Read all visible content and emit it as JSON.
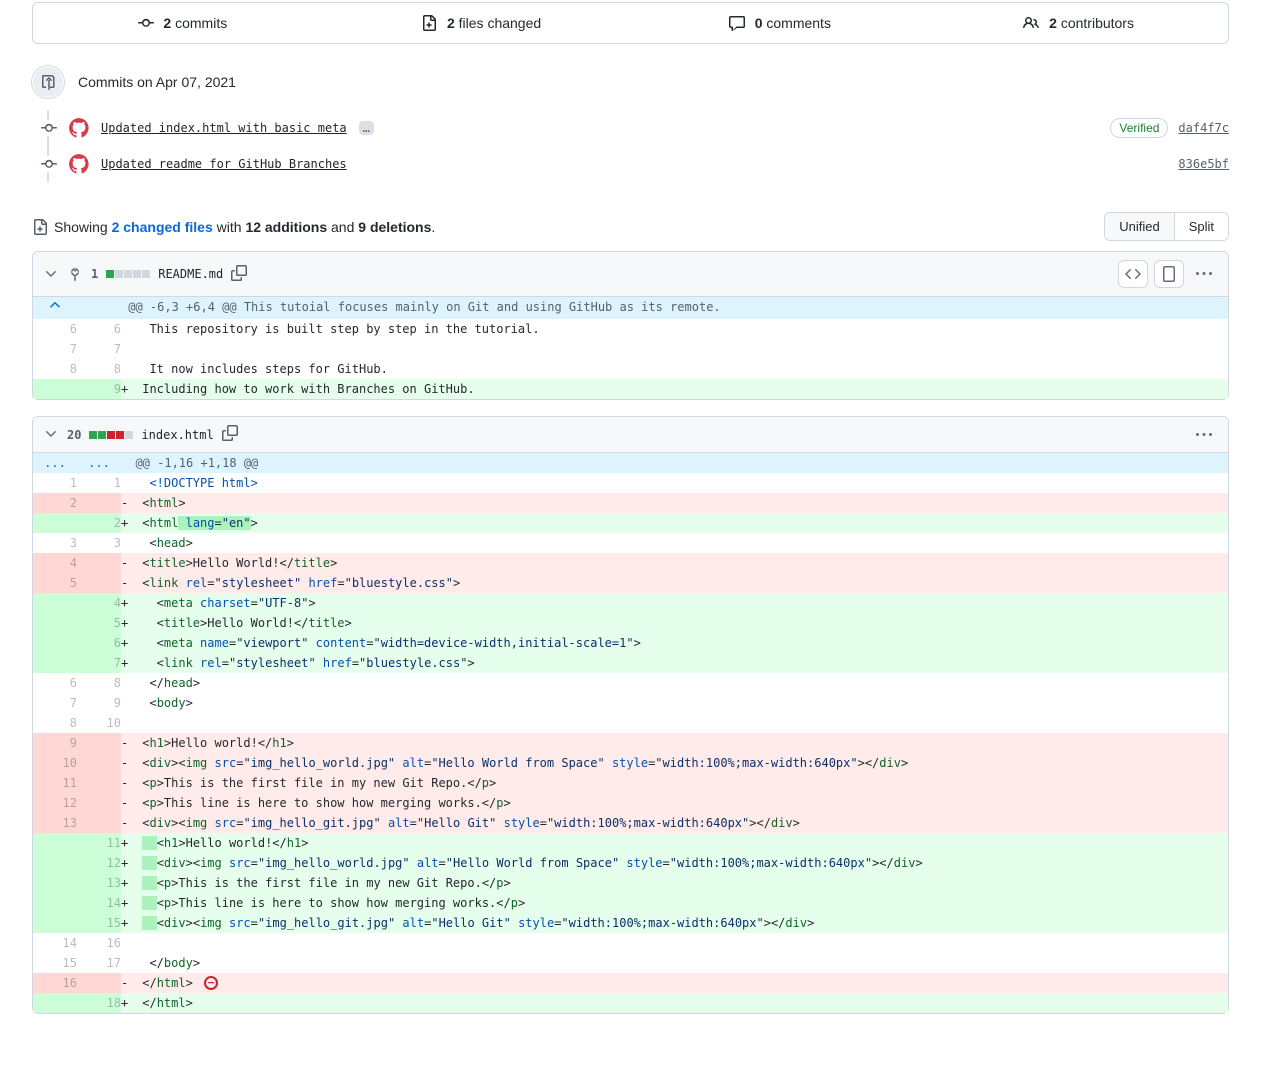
{
  "tabs": {
    "commits": {
      "icon": "git-commit",
      "count": "2",
      "label": "commits"
    },
    "files": {
      "icon": "file-diff",
      "count": "2",
      "label": "files changed"
    },
    "comments": {
      "icon": "comment",
      "count": "0",
      "label": "comments"
    },
    "contributors": {
      "icon": "people",
      "count": "2",
      "label": "contributors"
    }
  },
  "timeline": {
    "heading": "Commits on Apr 07, 2021",
    "items": [
      {
        "msg": "Updated index.html with basic meta",
        "more": "…",
        "verified": "Verified",
        "sha": "daf4f7c"
      },
      {
        "msg": "Updated readme for GitHub Branches",
        "sha": "836e5bf"
      }
    ]
  },
  "summary": {
    "showing": "Showing ",
    "files_link": "2 changed files",
    "with": " with ",
    "additions": "12 additions",
    "and": " and ",
    "deletions": "9 deletions",
    "unified": "Unified",
    "split": "Split"
  },
  "files": [
    {
      "name": "README.md",
      "count": "1",
      "blocks": {
        "a": 1,
        "d": 0,
        "n": 4
      },
      "hasViewTools": true,
      "hunks": [
        {
          "type": "hunk",
          "expand": "up",
          "text": " @@ -6,3 +6,4 @@ This tutoial focuses mainly on Git and using GitHub as its remote."
        },
        {
          "type": "ctx",
          "o": "6",
          "n": "6",
          "plain": "  This repository is built step by step in the tutorial."
        },
        {
          "type": "ctx",
          "o": "7",
          "n": "7",
          "plain": "  "
        },
        {
          "type": "ctx",
          "o": "8",
          "n": "8",
          "plain": "  It now includes steps for GitHub."
        },
        {
          "type": "add",
          "n": "9",
          "sign": "+",
          "plain": " Including how to work with Branches on GitHub."
        }
      ]
    },
    {
      "name": "index.html",
      "count": "20",
      "blocks": {
        "a": 2,
        "d": 2,
        "n": 1
      },
      "hasViewTools": false,
      "hunks": [
        {
          "type": "hunk",
          "expand": "dots",
          "text": "  @@ -1,16 +1,18 @@"
        },
        {
          "type": "ctx",
          "o": "1",
          "n": "1",
          "html": "  <span class='s-doc'>&lt;!DOCTYPE html&gt;</span>"
        },
        {
          "type": "del",
          "o": "2",
          "sign": "-",
          "html": " &lt;<span class='s-tag'>html</span>&gt;"
        },
        {
          "type": "add",
          "n": "2",
          "sign": "+",
          "html": " &lt;<span class='s-tag'>html</span><span class='ws-add'> <span class='s-attr'>lang</span>=<span class='s-str'>\"en\"</span></span>&gt;"
        },
        {
          "type": "ctx",
          "o": "3",
          "n": "3",
          "html": "  &lt;<span class='s-tag'>head</span>&gt;"
        },
        {
          "type": "del",
          "o": "4",
          "sign": "-",
          "html": " &lt;<span class='s-tag'>title</span>&gt;Hello World!&lt;/<span class='s-tag'>title</span>&gt;"
        },
        {
          "type": "del",
          "o": "5",
          "sign": "-",
          "html": " &lt;<span class='s-tag'>link</span> <span class='s-attr'>rel</span>=<span class='s-str'>\"stylesheet\"</span> <span class='s-attr'>href</span>=<span class='s-str'>\"bluestyle.css\"</span>&gt;"
        },
        {
          "type": "add",
          "n": "4",
          "sign": "+",
          "html": "   &lt;<span class='s-tag'>meta</span> <span class='s-attr'>charset</span>=<span class='s-str'>\"UTF-8\"</span>&gt;"
        },
        {
          "type": "add",
          "n": "5",
          "sign": "+",
          "html": "   &lt;<span class='s-tag'>title</span>&gt;Hello World!&lt;/<span class='s-tag'>title</span>&gt;"
        },
        {
          "type": "add",
          "n": "6",
          "sign": "+",
          "html": "   &lt;<span class='s-tag'>meta</span> <span class='s-attr'>name</span>=<span class='s-str'>\"viewport\"</span> <span class='s-attr'>content</span>=<span class='s-str'>\"width=device-width,initial-scale=1\"</span>&gt;"
        },
        {
          "type": "add",
          "n": "7",
          "sign": "+",
          "html": "   &lt;<span class='s-tag'>link</span> <span class='s-attr'>rel</span>=<span class='s-str'>\"stylesheet\"</span> <span class='s-attr'>href</span>=<span class='s-str'>\"bluestyle.css\"</span>&gt;"
        },
        {
          "type": "ctx",
          "o": "6",
          "n": "8",
          "html": "  &lt;/<span class='s-tag'>head</span>&gt;"
        },
        {
          "type": "ctx",
          "o": "7",
          "n": "9",
          "html": "  &lt;<span class='s-tag'>body</span>&gt;"
        },
        {
          "type": "ctx",
          "o": "8",
          "n": "10",
          "html": "  "
        },
        {
          "type": "del",
          "o": "9",
          "sign": "-",
          "html": " &lt;<span class='s-tag'>h1</span>&gt;Hello world!&lt;/<span class='s-tag'>h1</span>&gt;"
        },
        {
          "type": "del",
          "o": "10",
          "sign": "-",
          "html": " &lt;<span class='s-tag'>div</span>&gt;&lt;<span class='s-tag'>img</span> <span class='s-attr'>src</span>=<span class='s-str'>\"img_hello_world.jpg\"</span> <span class='s-attr'>alt</span>=<span class='s-str'>\"Hello World from Space\"</span> <span class='s-attr'>style</span>=<span class='s-str'>\"width:100%;max-width:640px\"</span>&gt;&lt;/<span class='s-tag'>div</span>&gt;"
        },
        {
          "type": "del",
          "o": "11",
          "sign": "-",
          "html": " &lt;<span class='s-tag'>p</span>&gt;This is the first file in my new Git Repo.&lt;/<span class='s-tag'>p</span>&gt;"
        },
        {
          "type": "del",
          "o": "12",
          "sign": "-",
          "html": " &lt;<span class='s-tag'>p</span>&gt;This line is here to show how merging works.&lt;/<span class='s-tag'>p</span>&gt;"
        },
        {
          "type": "del",
          "o": "13",
          "sign": "-",
          "html": " &lt;<span class='s-tag'>div</span>&gt;&lt;<span class='s-tag'>img</span> <span class='s-attr'>src</span>=<span class='s-str'>\"img_hello_git.jpg\"</span> <span class='s-attr'>alt</span>=<span class='s-str'>\"Hello Git\"</span> <span class='s-attr'>style</span>=<span class='s-str'>\"width:100%;max-width:640px\"</span>&gt;&lt;/<span class='s-tag'>div</span>&gt;"
        },
        {
          "type": "add",
          "n": "11",
          "sign": "+",
          "html": " <span class='ws-add'>  </span>&lt;<span class='s-tag'>h1</span>&gt;Hello world!&lt;/<span class='s-tag'>h1</span>&gt;"
        },
        {
          "type": "add",
          "n": "12",
          "sign": "+",
          "html": " <span class='ws-add'>  </span>&lt;<span class='s-tag'>div</span>&gt;&lt;<span class='s-tag'>img</span> <span class='s-attr'>src</span>=<span class='s-str'>\"img_hello_world.jpg\"</span> <span class='s-attr'>alt</span>=<span class='s-str'>\"Hello World from Space\"</span> <span class='s-attr'>style</span>=<span class='s-str'>\"width:100%;max-width:640px\"</span>&gt;&lt;/<span class='s-tag'>div</span>&gt;"
        },
        {
          "type": "add",
          "n": "13",
          "sign": "+",
          "html": " <span class='ws-add'>  </span>&lt;<span class='s-tag'>p</span>&gt;This is the first file in my new Git Repo.&lt;/<span class='s-tag'>p</span>&gt;"
        },
        {
          "type": "add",
          "n": "14",
          "sign": "+",
          "html": " <span class='ws-add'>  </span>&lt;<span class='s-tag'>p</span>&gt;This line is here to show how merging works.&lt;/<span class='s-tag'>p</span>&gt;"
        },
        {
          "type": "add",
          "n": "15",
          "sign": "+",
          "html": " <span class='ws-add'>  </span>&lt;<span class='s-tag'>div</span>&gt;&lt;<span class='s-tag'>img</span> <span class='s-attr'>src</span>=<span class='s-str'>\"img_hello_git.jpg\"</span> <span class='s-attr'>alt</span>=<span class='s-str'>\"Hello Git\"</span> <span class='s-attr'>style</span>=<span class='s-str'>\"width:100%;max-width:640px\"</span>&gt;&lt;/<span class='s-tag'>div</span>&gt;"
        },
        {
          "type": "ctx",
          "o": "14",
          "n": "16",
          "html": "  "
        },
        {
          "type": "ctx",
          "o": "15",
          "n": "17",
          "html": "  &lt;/<span class='s-tag'>body</span>&gt;"
        },
        {
          "type": "del",
          "o": "16",
          "sign": "-",
          "html": " &lt;/<span class='s-tag'>html</span>&gt; <span class='no-nl'>−</span>"
        },
        {
          "type": "add",
          "n": "18",
          "sign": "+",
          "html": " &lt;/<span class='s-tag'>html</span>&gt;"
        }
      ]
    }
  ]
}
